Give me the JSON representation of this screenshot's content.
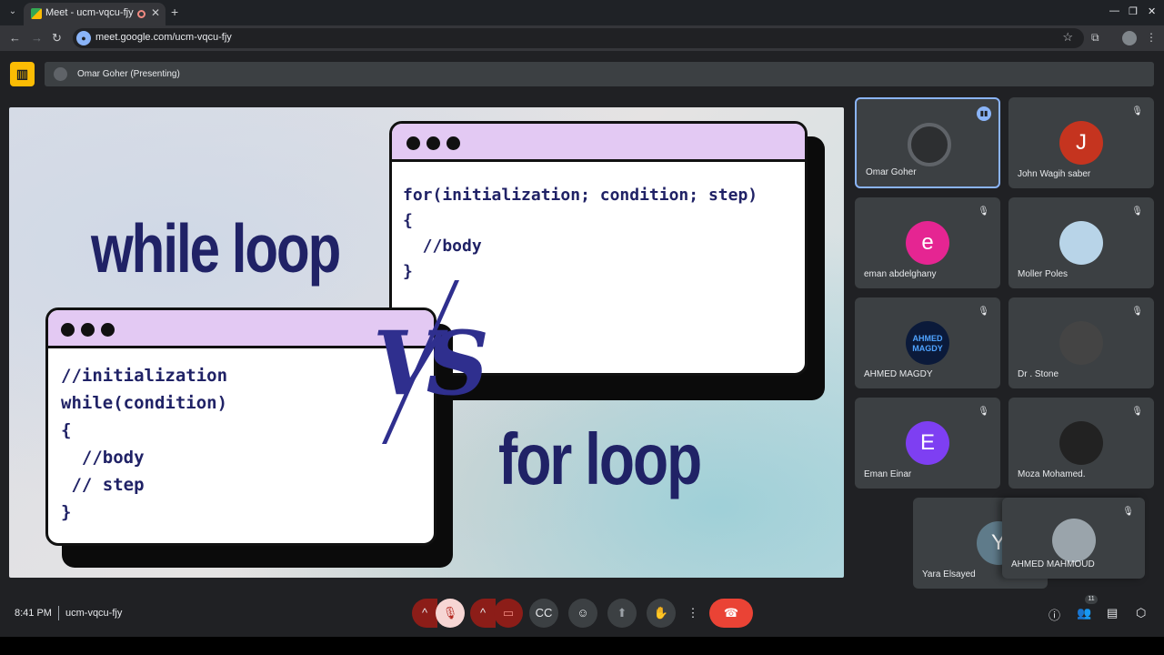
{
  "browser": {
    "tab_title": "Meet - ucm-vqcu-fjy",
    "tab_close": "✕",
    "new_tab": "+",
    "url": "meet.google.com/ucm-vqcu-fjy"
  },
  "meet": {
    "presenting_label": "Omar Goher (Presenting)"
  },
  "slide": {
    "heading_while": "while loop",
    "heading_for": "for loop",
    "vs": "VS",
    "for_code": "for(initialization; condition; step)\n{\n  //body\n}",
    "while_code": "//initialization\nwhile(condition)\n{\n  //body\n // step\n}"
  },
  "participants": [
    {
      "name": "Omar Goher",
      "initial": "",
      "color": "#2d2f31",
      "state": "speaking"
    },
    {
      "name": "John Wagih saber",
      "initial": "J",
      "color": "#c5341f",
      "state": "muted"
    },
    {
      "name": "eman abdelghany",
      "initial": "e",
      "color": "#e52592",
      "state": "muted"
    },
    {
      "name": "Moller Poles",
      "initial": "",
      "color": "#b8d4e8",
      "state": "muted"
    },
    {
      "name": "AHMED MAGDY",
      "initial": "AHMED MAGDY",
      "color": "#0b1a3a",
      "state": "muted"
    },
    {
      "name": "Dr . Stone",
      "initial": "",
      "color": "#444",
      "state": "muted"
    },
    {
      "name": "Eman Einar",
      "initial": "E",
      "color": "#7e3ff2",
      "state": "muted"
    },
    {
      "name": "Moza Mohamed.",
      "initial": "",
      "color": "#222",
      "state": "muted"
    },
    {
      "name": "Yara Elsayed",
      "initial": "Y",
      "color": "#5f7b8a",
      "state": ""
    },
    {
      "name": "AHMED MAHMOUD",
      "initial": "",
      "color": "#9aa4ab",
      "state": "muted"
    }
  ],
  "bottom": {
    "time": "8:41 PM",
    "meeting_code": "ucm-vqcu-fjy",
    "people_count": "11"
  },
  "colors": {
    "accent": "#8ab4f8",
    "hangup": "#ea4335",
    "slide_text": "#202266",
    "window_bar": "#e3c9f3"
  }
}
